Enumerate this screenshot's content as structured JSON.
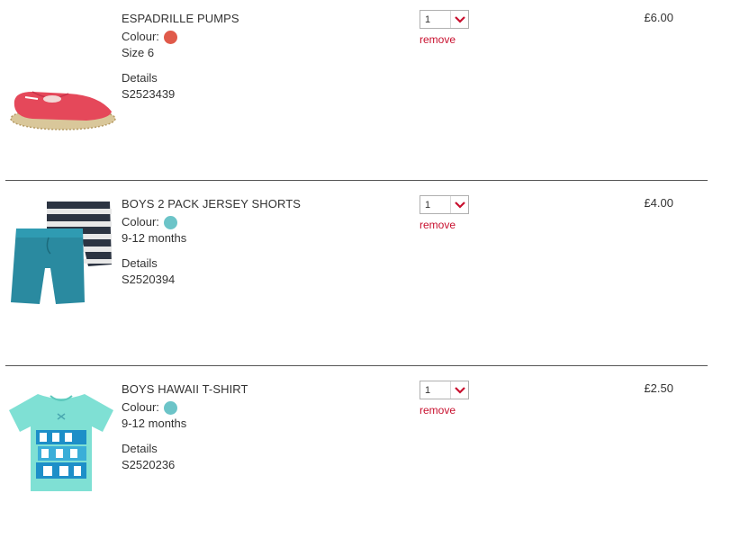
{
  "basket": {
    "colour_label": "Colour:",
    "details_label": "Details",
    "remove_label": "remove",
    "items": [
      {
        "name": "ESPADRILLE PUMPS",
        "colour_hex": "#e05a4a",
        "size": "Size 6",
        "code": "S2523439",
        "quantity": "1",
        "price": "£6.00",
        "image": "espadrille-pumps-image"
      },
      {
        "name": "BOYS 2 PACK JERSEY SHORTS",
        "colour_hex": "#6cc4c8",
        "size": "9-12 months",
        "code": "S2520394",
        "quantity": "1",
        "price": "£4.00",
        "image": "jersey-shorts-image"
      },
      {
        "name": "BOYS HAWAII T-SHIRT",
        "colour_hex": "#6cc4c8",
        "size": "9-12 months",
        "code": "S2520236",
        "quantity": "1",
        "price": "£2.50",
        "image": "hawaii-tshirt-image"
      }
    ]
  },
  "colors": {
    "accent": "#c8102e",
    "divider": "#555555"
  }
}
